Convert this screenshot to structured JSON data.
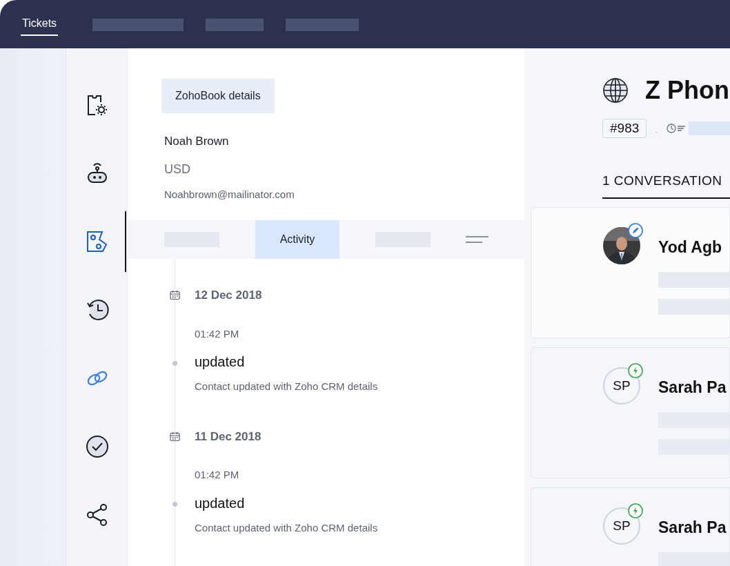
{
  "top_nav": {
    "tabs": [
      {
        "label": "Tickets",
        "selected": true
      }
    ]
  },
  "rail": {
    "items": [
      {
        "kind": "ticket-settings",
        "selected": false
      },
      {
        "kind": "bot",
        "selected": false
      },
      {
        "kind": "books",
        "selected": true
      },
      {
        "kind": "history",
        "selected": false
      },
      {
        "kind": "crm",
        "selected": false
      },
      {
        "kind": "check",
        "selected": false
      },
      {
        "kind": "share",
        "selected": false
      }
    ]
  },
  "contact_panel": {
    "button": "ZohoBook details",
    "name": "Noah Brown",
    "currency": "USD",
    "email": "Noahbrown@mailinator.com",
    "tabs": [
      {
        "label": "Activity",
        "selected": true
      }
    ],
    "activity": [
      {
        "date": "12 Dec 2018",
        "time": "01:42 PM",
        "action": "updated",
        "description": "Contact updated with Zoho CRM details"
      },
      {
        "date": "11 Dec 2018",
        "time": "01:42 PM",
        "action": "updated",
        "description": "Contact updated with Zoho CRM details"
      }
    ]
  },
  "ticket": {
    "title": "Z Phon",
    "number": "#983",
    "separator": ".",
    "tab": "1 CONVERSATION",
    "conversations": [
      {
        "badge": {
          "kind": "edit"
        },
        "name": "Yod Agb"
      },
      {
        "avatar": {
          "kind": "initials",
          "initials": "SP"
        },
        "badge": {
          "kind": "bolt"
        },
        "name": "Sarah Pa"
      },
      {
        "avatar": {
          "kind": "initials",
          "initials": "SP"
        },
        "badge": {
          "kind": "bolt"
        },
        "name": "Sarah Pa"
      }
    ]
  }
}
